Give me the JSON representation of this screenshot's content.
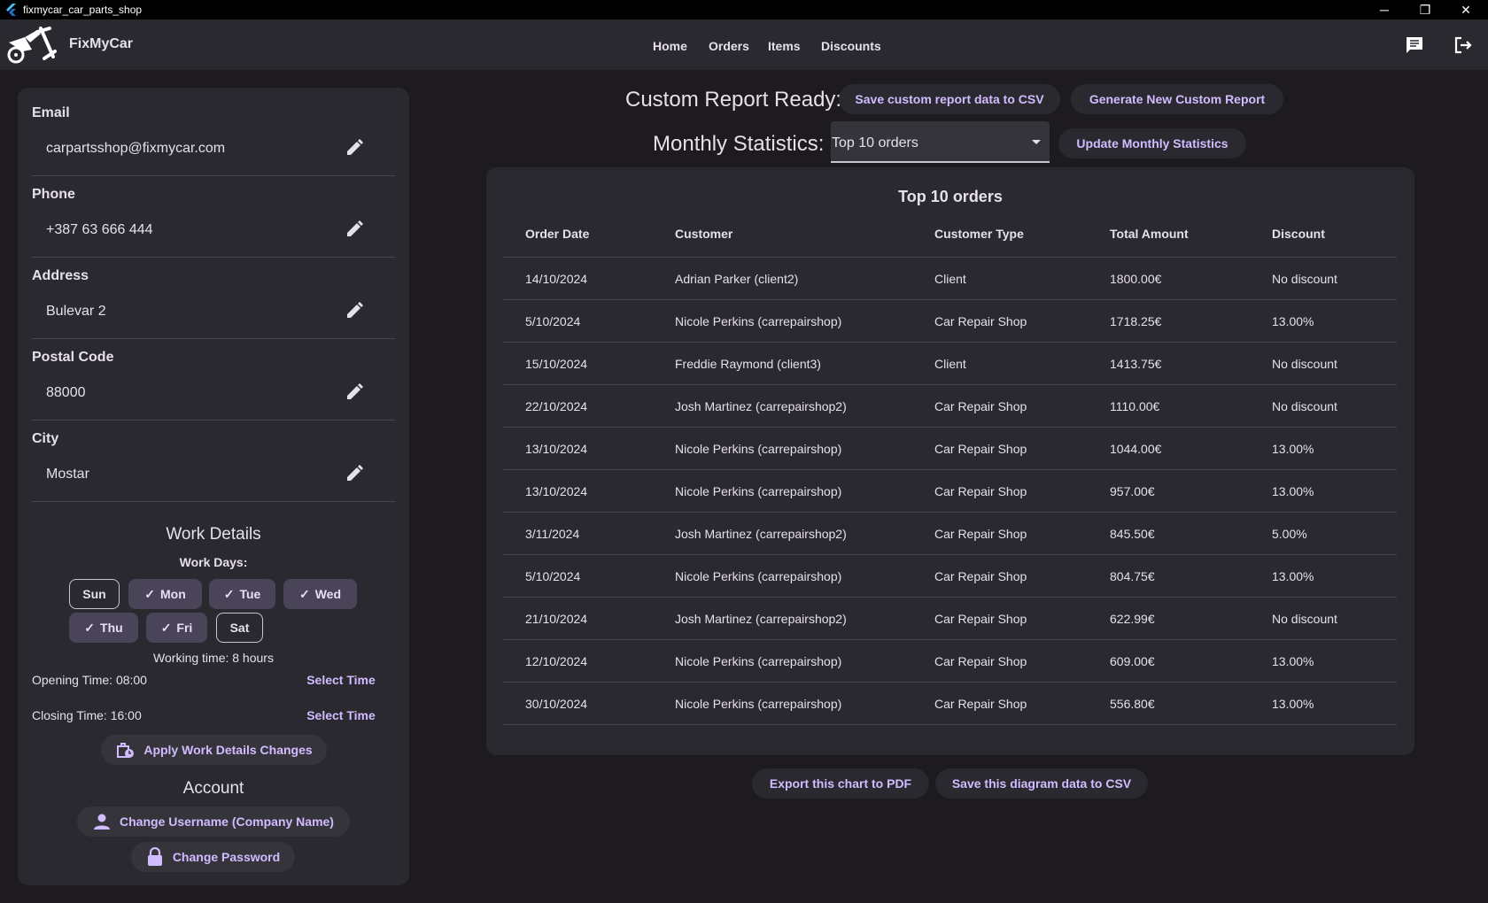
{
  "window": {
    "title": "fixmycar_car_parts_shop",
    "minimize": "─",
    "restore": "❐",
    "close": "✕"
  },
  "appbar": {
    "brand": "FixMyCar",
    "nav": [
      "Home",
      "Orders",
      "Items",
      "Discounts"
    ],
    "icons": [
      "chat-icon",
      "logout-icon"
    ]
  },
  "profile": {
    "fields": [
      {
        "label": "Email",
        "value": "carpartsshop@fixmycar.com"
      },
      {
        "label": "Phone",
        "value": "+387 63 666 444"
      },
      {
        "label": "Address",
        "value": "Bulevar 2"
      },
      {
        "label": "Postal Code",
        "value": "88000"
      },
      {
        "label": "City",
        "value": "Mostar"
      }
    ]
  },
  "work": {
    "title": "Work Details",
    "days_label": "Work Days:",
    "days": [
      {
        "label": "Sun",
        "selected": false
      },
      {
        "label": "Mon",
        "selected": true
      },
      {
        "label": "Tue",
        "selected": true
      },
      {
        "label": "Wed",
        "selected": true
      },
      {
        "label": "Thu",
        "selected": true
      },
      {
        "label": "Fri",
        "selected": true
      },
      {
        "label": "Sat",
        "selected": false
      }
    ],
    "working_time": "Working time: 8 hours",
    "opening": "Opening Time: 08:00",
    "closing": "Closing Time: 16:00",
    "select_time": "Select Time",
    "apply": "Apply Work Details Changes"
  },
  "account": {
    "title": "Account",
    "change_username": "Change Username (Company Name)",
    "change_password": "Change Password"
  },
  "report": {
    "custom_label": "Custom Report Ready:",
    "save_csv": "Save custom report data to CSV",
    "generate": "Generate New Custom Report",
    "monthly_label": "Monthly Statistics:",
    "monthly_selected": "Top 10 orders",
    "update": "Update Monthly Statistics"
  },
  "table": {
    "title": "Top 10 orders",
    "columns": [
      "Order Date",
      "Customer",
      "Customer Type",
      "Total Amount",
      "Discount"
    ],
    "rows": [
      [
        "14/10/2024",
        "Adrian Parker (client2)",
        "Client",
        "1800.00€",
        "No discount"
      ],
      [
        "5/10/2024",
        "Nicole Perkins (carrepairshop)",
        "Car Repair Shop",
        "1718.25€",
        "13.00%"
      ],
      [
        "15/10/2024",
        "Freddie Raymond (client3)",
        "Client",
        "1413.75€",
        "No discount"
      ],
      [
        "22/10/2024",
        "Josh Martinez (carrepairshop2)",
        "Car Repair Shop",
        "1110.00€",
        "No discount"
      ],
      [
        "13/10/2024",
        "Nicole Perkins (carrepairshop)",
        "Car Repair Shop",
        "1044.00€",
        "13.00%"
      ],
      [
        "13/10/2024",
        "Nicole Perkins (carrepairshop)",
        "Car Repair Shop",
        "957.00€",
        "13.00%"
      ],
      [
        "3/11/2024",
        "Josh Martinez (carrepairshop2)",
        "Car Repair Shop",
        "845.50€",
        "5.00%"
      ],
      [
        "5/10/2024",
        "Nicole Perkins (carrepairshop)",
        "Car Repair Shop",
        "804.75€",
        "13.00%"
      ],
      [
        "21/10/2024",
        "Josh Martinez (carrepairshop2)",
        "Car Repair Shop",
        "622.99€",
        "No discount"
      ],
      [
        "12/10/2024",
        "Nicole Perkins (carrepairshop)",
        "Car Repair Shop",
        "609.00€",
        "13.00%"
      ],
      [
        "30/10/2024",
        "Nicole Perkins (carrepairshop)",
        "Car Repair Shop",
        "556.80€",
        "13.00%"
      ]
    ]
  },
  "export": {
    "pdf": "Export this chart to PDF",
    "csv": "Save this diagram data to CSV"
  },
  "colors": {
    "background": "#1d1b20",
    "surface": "#2b2930",
    "accent": "#d0bcff",
    "chip_selected": "#4a4458"
  }
}
